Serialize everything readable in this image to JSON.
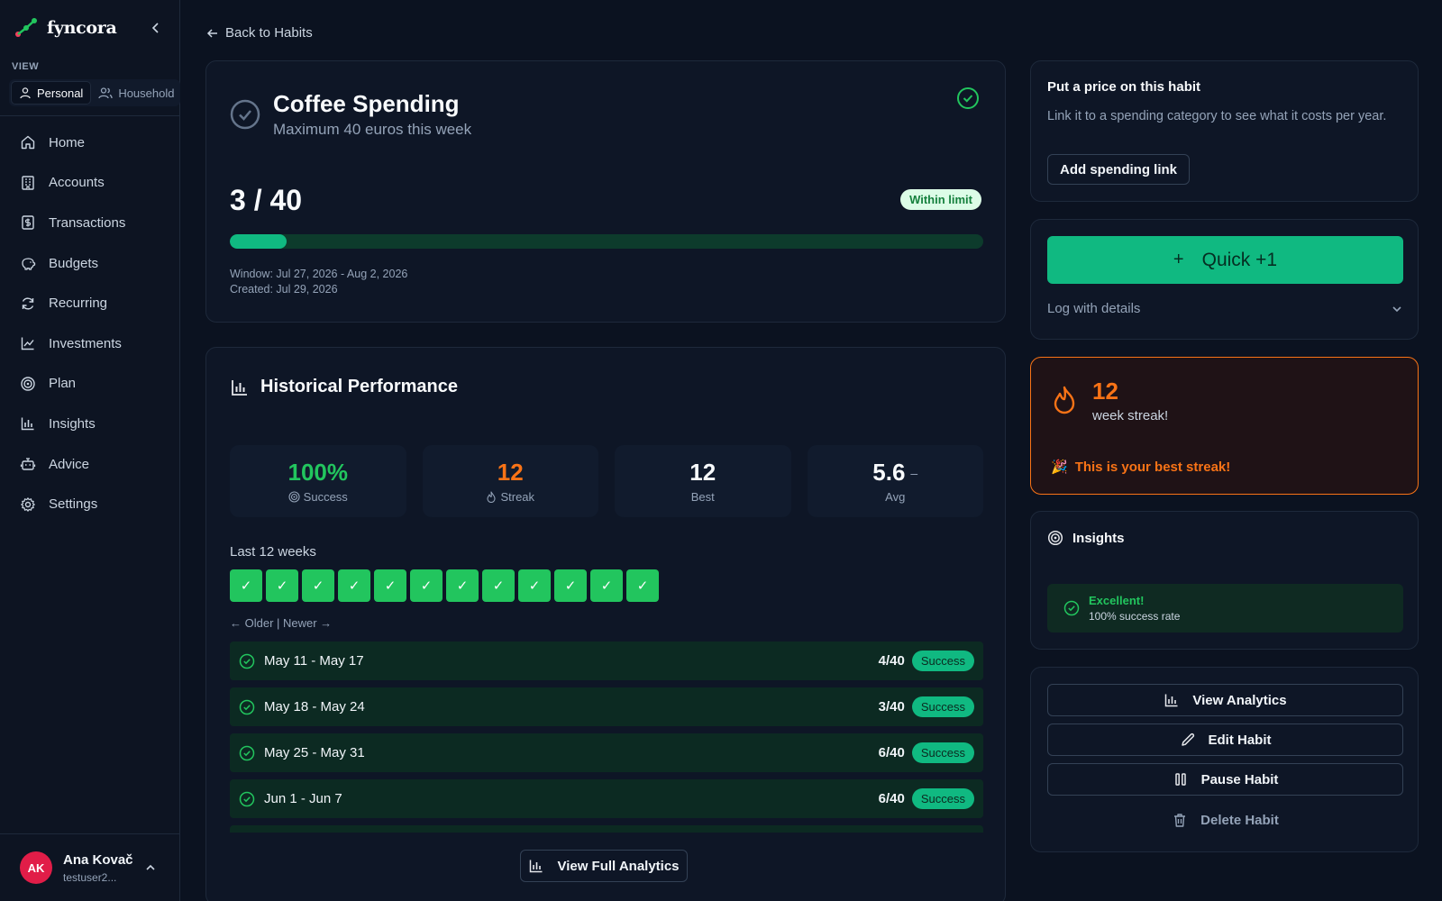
{
  "brand": {
    "name": "fyncora"
  },
  "sidebar": {
    "view_label": "VIEW",
    "view_options": [
      {
        "label": "Personal",
        "active": true
      },
      {
        "label": "Household",
        "active": false
      }
    ],
    "nav": [
      {
        "label": "Home",
        "icon": "home-icon"
      },
      {
        "label": "Accounts",
        "icon": "bank-icon"
      },
      {
        "label": "Transactions",
        "icon": "receipt-icon"
      },
      {
        "label": "Budgets",
        "icon": "piggy-bank-icon"
      },
      {
        "label": "Recurring",
        "icon": "refresh-icon"
      },
      {
        "label": "Investments",
        "icon": "trending-up-icon"
      },
      {
        "label": "Plan",
        "icon": "target-icon"
      },
      {
        "label": "Insights",
        "icon": "bar-chart-icon"
      },
      {
        "label": "Advice",
        "icon": "robot-icon"
      },
      {
        "label": "Settings",
        "icon": "gear-icon"
      }
    ],
    "user": {
      "initials": "AK",
      "name": "Ana Kovač",
      "email": "testuser2..."
    }
  },
  "back_link": "Back to Habits",
  "habit": {
    "title": "Coffee Spending",
    "subtitle": "Maximum 40 euros this week",
    "count": "3 / 40",
    "progress_fraction": 0.075,
    "limit_badge": "Within limit",
    "window": "Window: Jul 27, 2026 - Aug 2, 2026",
    "created": "Created: Jul 29, 2026"
  },
  "history": {
    "title": "Historical Performance",
    "stats": [
      {
        "value": "100%",
        "label": "Success",
        "color": "#22c55e"
      },
      {
        "value": "12",
        "label": "Streak",
        "color": "#f97316"
      },
      {
        "value": "12",
        "label": "Best",
        "color": "#f8fafc"
      },
      {
        "value": "5.6",
        "label": "Avg",
        "color": "#f8fafc",
        "trend": "–"
      }
    ],
    "weeks_label": "Last 12 weeks",
    "weeks": [
      "✓",
      "✓",
      "✓",
      "✓",
      "✓",
      "✓",
      "✓",
      "✓",
      "✓",
      "✓",
      "✓",
      "✓"
    ],
    "weeks_nav": "← Older | Newer →",
    "rows": [
      {
        "range": "May 11 - May 17",
        "value": "4/40",
        "status": "Success"
      },
      {
        "range": "May 18 - May 24",
        "value": "3/40",
        "status": "Success"
      },
      {
        "range": "May 25 - May 31",
        "value": "6/40",
        "status": "Success"
      },
      {
        "range": "Jun 1 - Jun 7",
        "value": "6/40",
        "status": "Success"
      },
      {
        "range": "",
        "value": "",
        "status": ""
      }
    ],
    "full_analytics": "View Full Analytics"
  },
  "price": {
    "title": "Put a price on this habit",
    "desc": "Link it to a spending category to see what it costs per year.",
    "button": "Add spending link"
  },
  "quick": {
    "plus": "+",
    "button": "Quick +1",
    "log": "Log with details"
  },
  "streak": {
    "number": "12",
    "label": "week streak!",
    "party": "🎉",
    "best": "This is your best streak!"
  },
  "insights": {
    "title": "Insights",
    "box_title": "Excellent!",
    "box_text": "100% success rate"
  },
  "actions": {
    "analytics": "View Analytics",
    "edit": "Edit Habit",
    "pause": "Pause Habit",
    "delete": "Delete Habit"
  }
}
